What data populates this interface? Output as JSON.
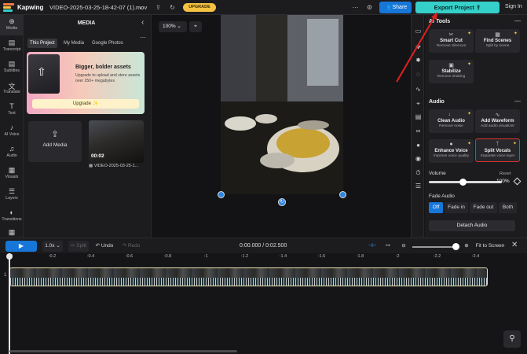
{
  "topbar": {
    "brand": "Kapwing",
    "filename": "VIDEO-2025-03-25-18-42-07 (1).mov",
    "upgrade": "UPGRADE",
    "share": "Share",
    "export": "Export Project",
    "signin": "Sign In",
    "logo_colors": [
      "#f27b45",
      "#f5c242",
      "#35d0c9"
    ]
  },
  "leftnav": [
    {
      "label": "Media",
      "icon": "plus-icon"
    },
    {
      "label": "Transcript",
      "icon": "transcript-icon"
    },
    {
      "label": "Subtitles",
      "icon": "subtitles-icon"
    },
    {
      "label": "Translate",
      "icon": "translate-icon"
    },
    {
      "label": "Text",
      "icon": "text-icon"
    },
    {
      "label": "AI Voice",
      "icon": "ai-voice-icon"
    },
    {
      "label": "Audio",
      "icon": "audio-icon"
    },
    {
      "label": "Visuals",
      "icon": "visuals-icon"
    },
    {
      "label": "Layers",
      "icon": "layers-icon"
    },
    {
      "label": "Transitions",
      "icon": "transitions-icon"
    },
    {
      "label": "",
      "icon": "grid-icon"
    }
  ],
  "media": {
    "title": "MEDIA",
    "tabs": [
      "This Project",
      "My Media",
      "Google Photos"
    ],
    "promo": {
      "heading": "Bigger, bolder assets",
      "text": "Upgrade to upload and store assets over 250+ megabytes",
      "button": "Upgrade ✨"
    },
    "add_media": "Add Media",
    "item": {
      "duration": "00:02",
      "name": "VIDEO-2025-03-25-1..."
    }
  },
  "canvas": {
    "zoom": "100%"
  },
  "right": {
    "ai_tools_title": "AI Tools",
    "ai_tools": [
      {
        "title": "Smart Cut",
        "sub": "Remove Silences",
        "icon": "scissors-icon"
      },
      {
        "title": "Find Scenes",
        "sub": "Split by scene",
        "icon": "scenes-icon"
      },
      {
        "title": "Stabilize",
        "sub": "Remove shaking",
        "icon": "stabilize-icon"
      }
    ],
    "audio_title": "Audio",
    "audio_tools": [
      {
        "title": "Clean Audio",
        "sub": "Remove noise",
        "icon": "clean-audio-icon"
      },
      {
        "title": "Add Waveform",
        "sub": "Add audio visualizer",
        "icon": "waveform-icon"
      },
      {
        "title": "Enhance Voice",
        "sub": "Improve voice quality",
        "icon": "mic-icon"
      },
      {
        "title": "Split Vocals",
        "sub": "Separate voice layer",
        "icon": "split-icon"
      }
    ],
    "volume_label": "Volume",
    "reset": "Reset",
    "volume_value": "100%",
    "volume_level": 1.0,
    "fade_label": "Fade Audio",
    "fade_options": [
      "Off",
      "Fade in",
      "Fade out",
      "Both"
    ],
    "fade_selected": "Off",
    "detach": "Detach Audio"
  },
  "timeline": {
    "speed": "1.0x",
    "split": "Split",
    "undo": "Undo",
    "redo": "Redo",
    "time": "0:00.000 / 0:02.500",
    "fit": "Fit to Screen",
    "track_number": "1",
    "ticks": [
      "0",
      ":0.2",
      ":0.4",
      ":0.6",
      ":0.8",
      ":1",
      ":1.2",
      ":1.4",
      ":1.6",
      ":1.8",
      ":2",
      ":2.2",
      ":2.4"
    ]
  },
  "colors": {
    "accent": "#1677d8",
    "export": "#35d0c9",
    "highlight": "#e03030",
    "upgrade": "#f5c242"
  }
}
